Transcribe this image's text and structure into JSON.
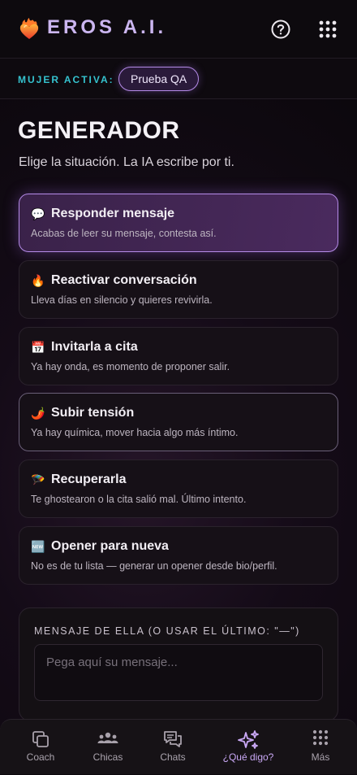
{
  "header": {
    "title": "EROS A.I.",
    "help_icon": "help-circle-icon",
    "menu_icon": "apps-grid-icon"
  },
  "active": {
    "label": "MUJER ACTIVA:",
    "chip": "Prueba QA"
  },
  "page": {
    "title": "GENERADOR",
    "subtitle": "Elige la situación. La IA escribe por ti."
  },
  "situations": [
    {
      "emoji": "💬",
      "title": "Responder mensaje",
      "desc": "Acabas de leer su mensaje, contesta así.",
      "selected": true
    },
    {
      "emoji": "🔥",
      "title": "Reactivar conversación",
      "desc": "Lleva días en silencio y quieres revivirla.",
      "selected": false
    },
    {
      "emoji": "📅",
      "title": "Invitarla a cita",
      "desc": "Ya hay onda, es momento de proponer salir.",
      "selected": false
    },
    {
      "emoji": "🌶️",
      "title": "Subir tensión",
      "desc": "Ya hay química, mover hacia algo más íntimo.",
      "selected": false
    },
    {
      "emoji": "🪂",
      "title": "Recuperarla",
      "desc": "Te ghostearon o la cita salió mal. Último intento.",
      "selected": false
    },
    {
      "emoji": "🆕",
      "title": "Opener para nueva",
      "desc": "No es de tu lista — generar un opener desde bio/perfil.",
      "selected": false
    }
  ],
  "message": {
    "label": "MENSAJE DE ELLA (O USAR EL ÚLTIMO: \"—\")",
    "placeholder": "Pega aquí su mensaje...",
    "value": ""
  },
  "nav": [
    {
      "label": "Coach",
      "icon": "coach-icon"
    },
    {
      "label": "Chicas",
      "icon": "people-icon"
    },
    {
      "label": "Chats",
      "icon": "chat-icon"
    },
    {
      "label": "¿Qué digo?",
      "icon": "sparkles-icon",
      "active": true
    },
    {
      "label": "Más",
      "icon": "more-grid-icon"
    }
  ],
  "colors": {
    "accent": "#b58be8",
    "active_label": "#35c3cf",
    "title": "#cbb6f0"
  }
}
